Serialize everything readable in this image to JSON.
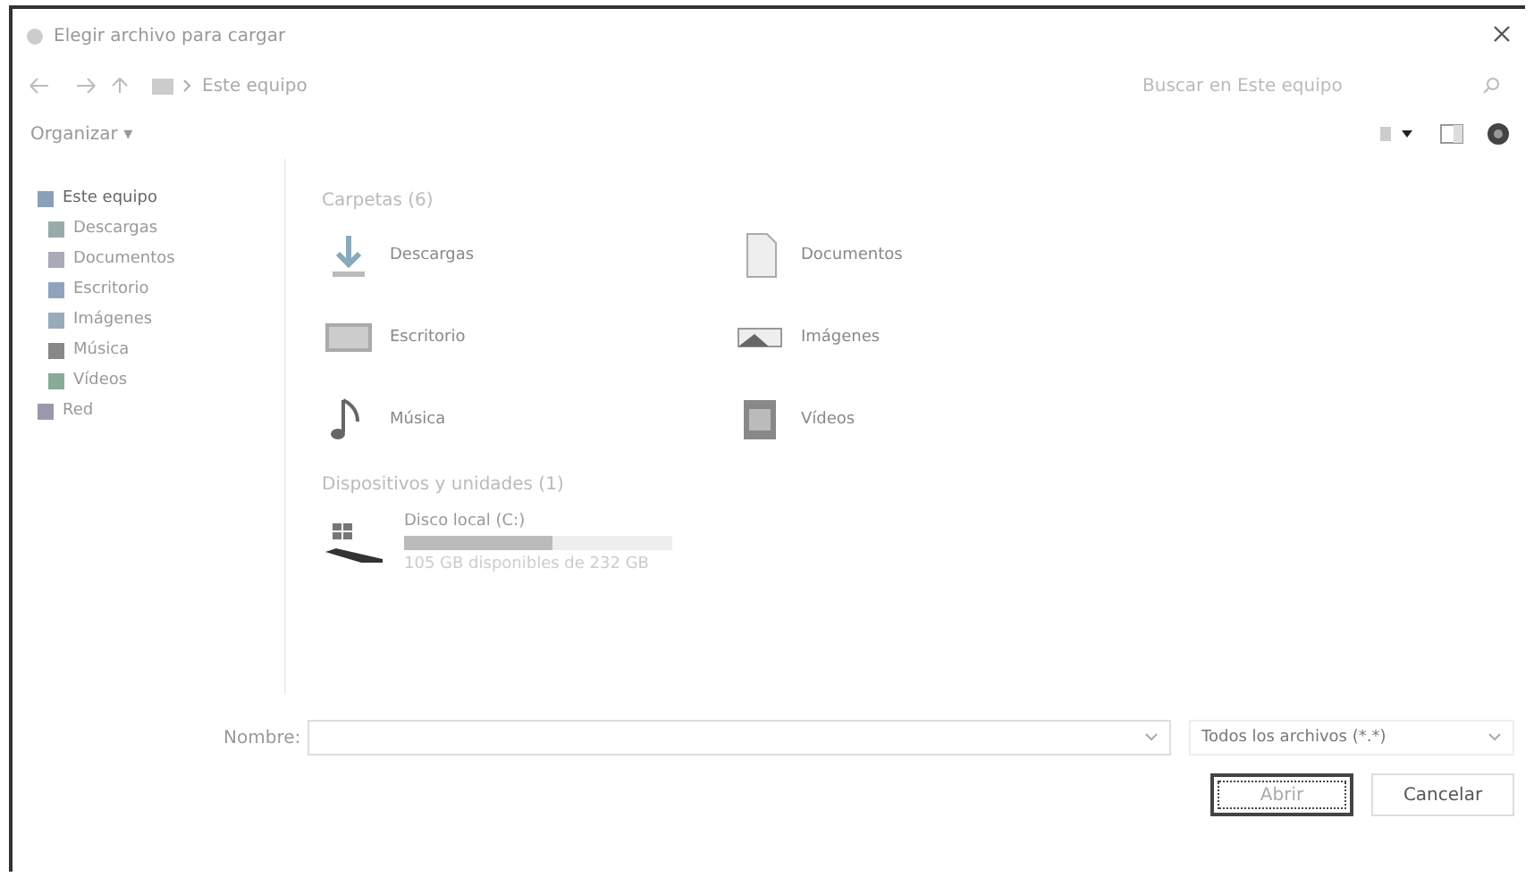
{
  "window": {
    "title": "Elegir archivo para cargar"
  },
  "address": {
    "path": "Este equipo",
    "search_placeholder": "Buscar en Este equipo"
  },
  "toolbar": {
    "organize": "Organizar ▾"
  },
  "sidebar": {
    "items": [
      {
        "label": "Este equipo",
        "selected": true,
        "kind": "pc",
        "children": [
          {
            "label": "Descargas",
            "selected": false,
            "kind": "download"
          },
          {
            "label": "Documentos",
            "selected": false,
            "kind": "doc"
          },
          {
            "label": "Escritorio",
            "selected": false,
            "kind": "desktop"
          },
          {
            "label": "Imágenes",
            "selected": false,
            "kind": "image"
          },
          {
            "label": "Música",
            "selected": false,
            "kind": "music"
          },
          {
            "label": "Vídeos",
            "selected": false,
            "kind": "video"
          }
        ]
      },
      {
        "label": "Red",
        "selected": false,
        "kind": "network"
      }
    ]
  },
  "folders": {
    "heading": "Carpetas (6)",
    "items": [
      {
        "label": "Descargas",
        "kind": "download"
      },
      {
        "label": "Documentos",
        "kind": "doc"
      },
      {
        "label": "Escritorio",
        "kind": "desktop"
      },
      {
        "label": "Imágenes",
        "kind": "image"
      },
      {
        "label": "Música",
        "kind": "music"
      },
      {
        "label": "Vídeos",
        "kind": "video"
      }
    ]
  },
  "devices": {
    "heading": "Dispositivos y unidades (1)",
    "items": [
      {
        "label": "Disco local (C:)",
        "level": 0.55,
        "free": "105 GB disponibles de 232 GB"
      }
    ]
  },
  "footer": {
    "name_label": "Nombre:",
    "filter": "Todos los archivos (*.*)",
    "buttons": [
      {
        "label": "Abrir",
        "selected": true
      },
      {
        "label": "Cancelar",
        "selected": false
      }
    ]
  }
}
